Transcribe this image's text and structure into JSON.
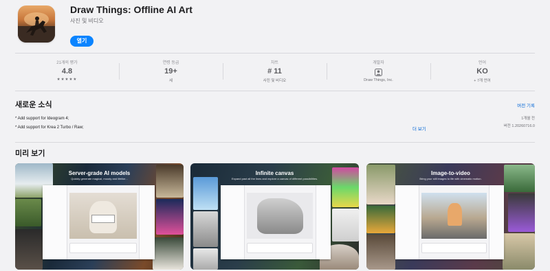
{
  "app": {
    "title": "Draw Things: Offline AI Art",
    "subtitle": "사진 및 비디오",
    "open_label": "열기"
  },
  "stats": [
    {
      "label": "21개의 평가",
      "value": "4.8",
      "sub": "★★★★★"
    },
    {
      "label": "연령 등급",
      "value": "19+",
      "sub": "세"
    },
    {
      "label": "차트",
      "value": "# 11",
      "sub": "사진 및 비디오"
    },
    {
      "label": "개발자",
      "value": "",
      "sub": "Draw Things, Inc."
    },
    {
      "label": "언어",
      "value": "KO",
      "sub": "+ 7개 언어"
    }
  ],
  "news": {
    "title": "새로운 소식",
    "history_link": "버전 기록",
    "items": [
      "* Add support for Ideogram 4;",
      "* Add support for Krea 2 Turbo / Raw;"
    ],
    "more_label": "더 보기",
    "date": "1개월 전",
    "version": "버전 1.20260716.0"
  },
  "preview": {
    "title": "미리 보기",
    "shots": [
      {
        "title": "Server-grade AI models",
        "sub": "Quickly generate magical, moody and lifelike..."
      },
      {
        "title": "Infinite canvas",
        "sub": "Expand past all the lines and explore a canvas of different possibilities."
      },
      {
        "title": "Image-to-video",
        "sub": "Bring your still images to life with cinematic motion."
      }
    ]
  },
  "icons": {
    "developer": "person-icon",
    "app": "horse-rider-icon"
  },
  "colors": {
    "accent": "#0a84ff",
    "link": "#0a6ad6",
    "background": "#f2f2f4"
  }
}
